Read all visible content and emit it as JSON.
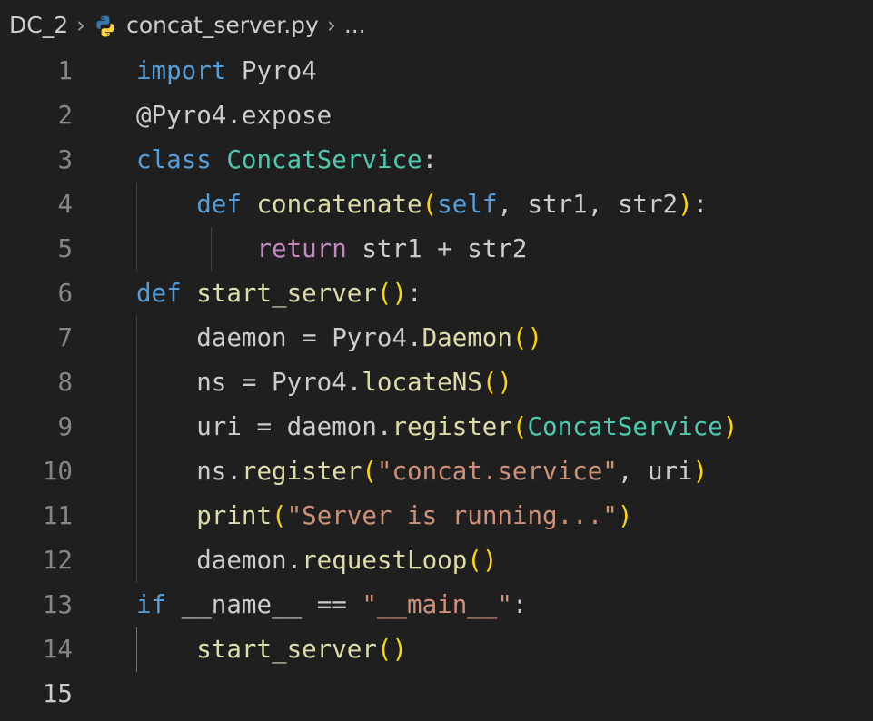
{
  "breadcrumb": {
    "folder": "DC_2",
    "separator": "›",
    "file": "concat_server.py",
    "tail": "...",
    "file_icon": "python-icon"
  },
  "editor": {
    "active_line": 15,
    "lines": [
      {
        "number": "1",
        "text": "import Pyro4"
      },
      {
        "number": "2",
        "text": "@Pyro4.expose"
      },
      {
        "number": "3",
        "text": "class ConcatService:"
      },
      {
        "number": "4",
        "text": "    def concatenate(self, str1, str2):"
      },
      {
        "number": "5",
        "text": "        return str1 + str2"
      },
      {
        "number": "6",
        "text": "def start_server():"
      },
      {
        "number": "7",
        "text": "    daemon = Pyro4.Daemon()"
      },
      {
        "number": "8",
        "text": "    ns = Pyro4.locateNS()"
      },
      {
        "number": "9",
        "text": "    uri = daemon.register(ConcatService)"
      },
      {
        "number": "10",
        "text": "    ns.register(\"concat.service\", uri)"
      },
      {
        "number": "11",
        "text": "    print(\"Server is running...\")"
      },
      {
        "number": "12",
        "text": "    daemon.requestLoop()"
      },
      {
        "number": "13",
        "text": "if __name__ == \"__main__\":"
      },
      {
        "number": "14",
        "text": "    start_server()"
      },
      {
        "number": "15",
        "text": ""
      }
    ]
  },
  "colors": {
    "background": "#1f1f1f",
    "keyword": "#569cd6",
    "control_keyword": "#c586c0",
    "function": "#dcdcaa",
    "class": "#4ec9b0",
    "string": "#ce9178",
    "bracket": "#ffd700",
    "line_number": "#858585",
    "active_line_number": "#cccccc"
  }
}
